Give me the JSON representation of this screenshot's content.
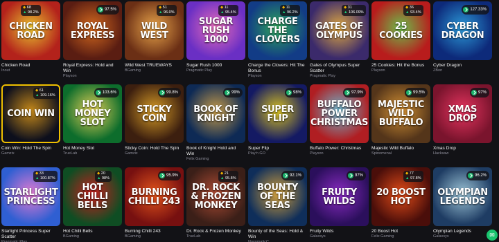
{
  "games": [
    {
      "name": "Chicken Road",
      "provider": "Inout",
      "art": "Chicken Road",
      "rtp": "",
      "stat1": "68",
      "stat2": "98.2%",
      "bg": "#b3221b",
      "bg2": "#e8c230",
      "stat_left": true
    },
    {
      "name": "Royal Express: Hold and Win",
      "provider": "Playson",
      "art": "Royal Express",
      "rtp": "97.5%",
      "stat1": "",
      "stat2": "",
      "bg": "#5a1d12",
      "bg2": "#d46a1f"
    },
    {
      "name": "Wild West TRUEWAYS",
      "provider": "BGaming",
      "art": "Wild West",
      "rtp": "",
      "stat1": "51",
      "stat2": "96.0%",
      "bg": "#6b2f15",
      "bg2": "#e9a54b"
    },
    {
      "name": "Sugar Rush 1000",
      "provider": "Pragmatic Play",
      "art": "Sugar Rush 1000",
      "rtp": "",
      "stat1": "11",
      "stat2": "95.4%",
      "bg": "#6a2fc4",
      "bg2": "#e86cb9"
    },
    {
      "name": "Charge the Clovers: Hit The Bonus",
      "provider": "Playson",
      "art": "Charge the Clovers",
      "rtp": "",
      "stat1": "11",
      "stat2": "96.2%",
      "bg": "#123c86",
      "bg2": "#2fa75a"
    },
    {
      "name": "Gates of Olympus Super Scatter",
      "provider": "Pragmatic Play",
      "art": "Gates of Olympus",
      "rtp": "",
      "stat1": "31",
      "stat2": "106.09%",
      "bg": "#3b2a6b",
      "bg2": "#e0a941"
    },
    {
      "name": "25 Cookies: Hit the Bonus",
      "provider": "Playson",
      "art": "25 Cookies",
      "rtp": "",
      "stat1": "36",
      "stat2": "93.4%",
      "bg": "#b81c1c",
      "bg2": "#6cbe4b"
    },
    {
      "name": "Cyber Dragon",
      "provider": "ZBon",
      "art": "Cyber Dragon",
      "rtp": "127.33%",
      "stat1": "",
      "stat2": "",
      "bg": "#0d2a7a",
      "bg2": "#2c9ad8"
    },
    {
      "name": "Coin Win: Hold The Spin",
      "provider": "Gamzix",
      "art": "Coin Win",
      "rtp": "",
      "stat1": "61",
      "stat2": "109.16%",
      "bg": "#0d0f1c",
      "bg2": "#c4881a",
      "hl": true
    },
    {
      "name": "Hot Money Slot",
      "provider": "TrueLab",
      "art": "Hot Money Slot",
      "rtp": "103.6%",
      "stat1": "",
      "stat2": "",
      "bg": "#0d6d2c",
      "bg2": "#e3cf56"
    },
    {
      "name": "Sticky Coin: Hold The Spin",
      "provider": "Gamzix",
      "art": "Sticky Coin",
      "rtp": "99.8%",
      "stat1": "",
      "stat2": "",
      "bg": "#3c1f0f",
      "bg2": "#d69b26"
    },
    {
      "name": "Book of Knight Hold and Win",
      "provider": "Felix Gaming",
      "art": "Book of Knight",
      "rtp": "99%",
      "stat1": "",
      "stat2": "",
      "bg": "#0e2a55",
      "bg2": "#c49a49"
    },
    {
      "name": "Super Flip",
      "provider": "Play'n GO",
      "art": "Super Flip",
      "rtp": "98%",
      "stat1": "",
      "stat2": "",
      "bg": "#141a63",
      "bg2": "#d6c021"
    },
    {
      "name": "Buffalo Power: Christmas",
      "provider": "Playson",
      "art": "Buffalo Power Christmas",
      "rtp": "97.9%",
      "stat1": "",
      "stat2": "",
      "bg": "#b01e22",
      "bg2": "#6bb7ce"
    },
    {
      "name": "Majestic Wild Buffalo",
      "provider": "Spinomenal",
      "art": "Majestic Wild Buffalo",
      "rtp": "99.5%",
      "stat1": "",
      "stat2": "",
      "bg": "#54351a",
      "bg2": "#d49133"
    },
    {
      "name": "Xmas Drop",
      "provider": "Hacksaw",
      "art": "Xmas Drop",
      "rtp": "97%",
      "stat1": "",
      "stat2": "",
      "bg": "#7a142d",
      "bg2": "#e5345f"
    },
    {
      "name": "Starlight Princess Super Scatter",
      "provider": "Pragmatic Play",
      "art": "Starlight Princess",
      "rtp": "",
      "stat1": "33",
      "stat2": "100.87%",
      "bg": "#2f5fd2",
      "bg2": "#e37ad1"
    },
    {
      "name": "Hot Chilli Bells",
      "provider": "BGaming",
      "art": "Hot Chilli Bells",
      "rtp": "",
      "stat1": "20",
      "stat2": "98%",
      "bg": "#0f4d23",
      "bg2": "#c81e1e"
    },
    {
      "name": "Burning Chilli 243",
      "provider": "BGaming",
      "art": "Burning Chilli 243",
      "rtp": "95.9%",
      "stat1": "",
      "stat2": "",
      "bg": "#771010",
      "bg2": "#e3541b"
    },
    {
      "name": "Dr. Rock & Frozen Monkey",
      "provider": "TrueLab",
      "art": "Dr. Rock & Frozen Monkey",
      "rtp": "",
      "stat1": "21",
      "stat2": "95.8%",
      "bg": "#3b1f18",
      "bg2": "#b04c34"
    },
    {
      "name": "Bounty of the Seas: Hold & Win",
      "provider": "NovomaticC",
      "art": "Bounty of the Seas",
      "rtp": "92.1%",
      "stat1": "",
      "stat2": "",
      "bg": "#0f2e5a",
      "bg2": "#d2a03d"
    },
    {
      "name": "Fruity Wilds",
      "provider": "Galaxsys",
      "art": "Fruity Wilds",
      "rtp": "97%",
      "stat1": "",
      "stat2": "",
      "bg": "#2b0f5c",
      "bg2": "#8a2bc2"
    },
    {
      "name": "20 Boost Hot",
      "provider": "Felix Gaming",
      "art": "20 Boost Hot",
      "rtp": "",
      "stat1": "77",
      "stat2": "97.8%",
      "bg": "#4a0e0a",
      "bg2": "#e24b18"
    },
    {
      "name": "Olympian Legends",
      "provider": "Galaxsys",
      "art": "Olympian Legends",
      "rtp": "96.2%",
      "stat1": "",
      "stat2": "",
      "bg": "#1e3c63",
      "bg2": "#9cc4d6"
    }
  ],
  "fab_icon": "chat-icon",
  "colors": {
    "accent": "#19c46e",
    "background": "#121216",
    "highlight": "#f0c000"
  }
}
